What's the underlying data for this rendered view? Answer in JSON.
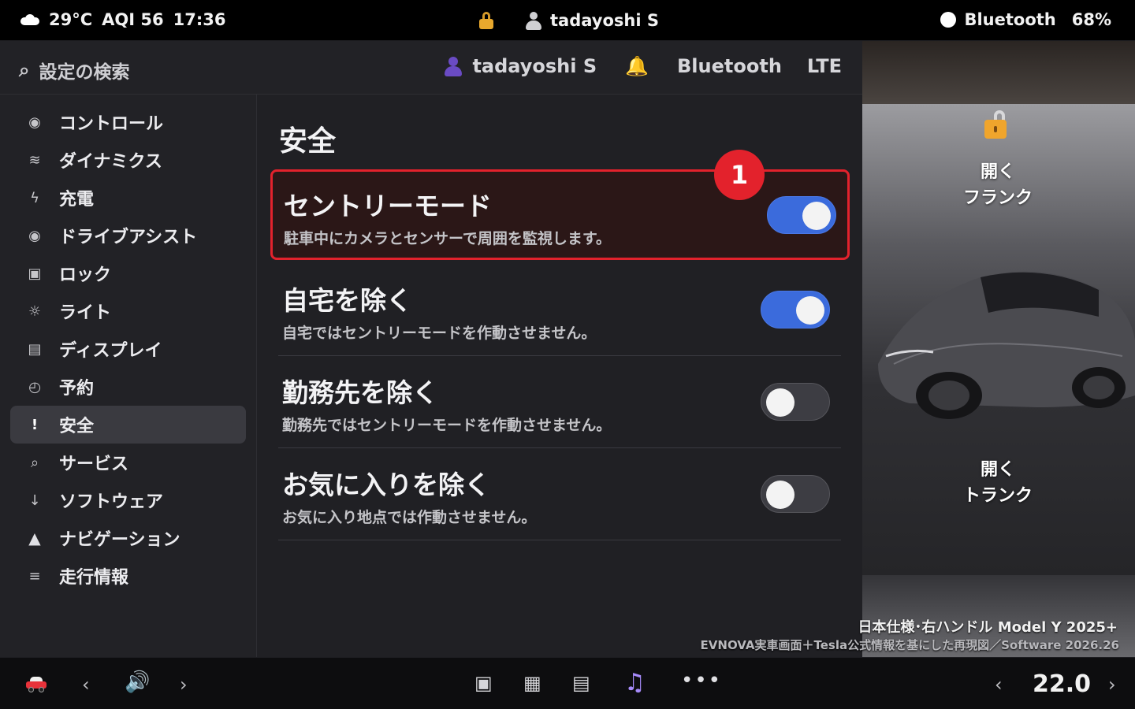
{
  "status_bar": {
    "temperature": "29°C",
    "aqi": "AQI 56",
    "time": "17:36",
    "user": "tadayoshi S",
    "bluetooth": "Bluetooth",
    "battery": "68%"
  },
  "header": {
    "search_placeholder": "設定の検索",
    "user": "tadayoshi S",
    "bluetooth": "Bluetooth",
    "network": "LTE"
  },
  "sidebar": {
    "items": [
      {
        "label": "コントロール",
        "icon": "◉"
      },
      {
        "label": "ダイナミクス",
        "icon": "≋"
      },
      {
        "label": "充電",
        "icon": "ϟ"
      },
      {
        "label": "ドライブアシスト",
        "icon": "◉"
      },
      {
        "label": "ロック",
        "icon": "▣"
      },
      {
        "label": "ライト",
        "icon": "☼"
      },
      {
        "label": "ディスプレイ",
        "icon": "▤"
      },
      {
        "label": "予約",
        "icon": "◴"
      },
      {
        "label": "安全",
        "icon": "!"
      },
      {
        "label": "サービス",
        "icon": "⌕"
      },
      {
        "label": "ソフトウェア",
        "icon": "↓"
      },
      {
        "label": "ナビゲーション",
        "icon": "▲"
      },
      {
        "label": "走行情報",
        "icon": "≡"
      }
    ],
    "active_index": 8
  },
  "content": {
    "title": "安全",
    "highlight_badge": "1",
    "rows": [
      {
        "title": "セントリーモード",
        "desc": "駐車中にカメラとセンサーで周囲を監視します。",
        "on": true
      },
      {
        "title": "自宅を除く",
        "desc": "自宅ではセントリーモードを作動させません。",
        "on": true
      },
      {
        "title": "勤務先を除く",
        "desc": "勤務先ではセントリーモードを作動させません。",
        "on": false
      },
      {
        "title": "お気に入りを除く",
        "desc": "お気に入り地点では作動させません。",
        "on": false
      }
    ]
  },
  "car_panel": {
    "frunk_action": "開く",
    "frunk_label": "フランク",
    "trunk_action": "開く",
    "trunk_label": "トランク",
    "credit_line1": "日本仕様･右ハンドル Model Y 2025+",
    "credit_line2": "EVNOVA実車画面＋Tesla公式情報を基にした再現図／Software 2026.26"
  },
  "bottom_bar": {
    "temperature": "22.0"
  },
  "colors": {
    "accent_blue": "#3b6bdc",
    "alert_red": "#e3222c",
    "lock_gold": "#e8a82d",
    "music_purple": "#a78bfa"
  }
}
